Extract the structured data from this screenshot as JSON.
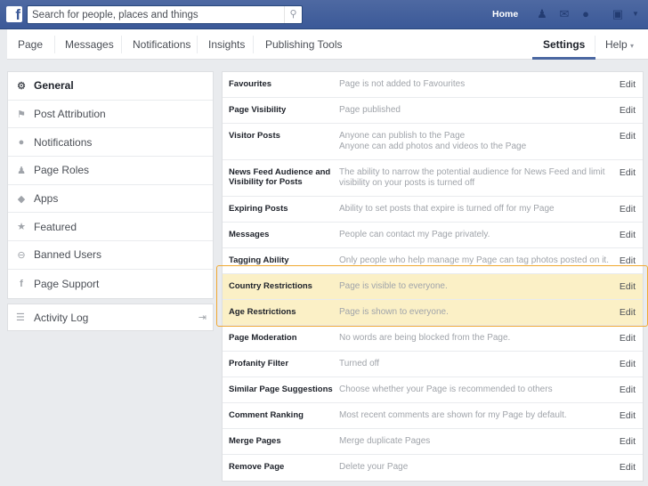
{
  "topbar": {
    "logo": "f",
    "search_placeholder": "Search for people, places and things",
    "search_icon": "search-icon",
    "home_label": "Home",
    "icons": [
      "friend-requests-icon",
      "messages-icon",
      "notifications-globe-icon",
      "account-icon",
      "chevron-down-icon"
    ]
  },
  "pagenav": {
    "tabs": [
      {
        "label": "Page"
      },
      {
        "label": "Messages"
      },
      {
        "label": "Notifications"
      },
      {
        "label": "Insights"
      },
      {
        "label": "Publishing Tools"
      }
    ],
    "settings_label": "Settings",
    "help_label": "Help",
    "help_caret": "▾",
    "active_color": "#4b67a1"
  },
  "sidebar": {
    "items": [
      {
        "label": "General",
        "icon": "gear-icon",
        "glyph": "⚙",
        "active": true
      },
      {
        "label": "Post Attribution",
        "icon": "flag-icon",
        "glyph": "⚑"
      },
      {
        "label": "Notifications",
        "icon": "globe-icon",
        "glyph": "●"
      },
      {
        "label": "Page Roles",
        "icon": "person-icon",
        "glyph": "♟"
      },
      {
        "label": "Apps",
        "icon": "cube-icon",
        "glyph": "◆"
      },
      {
        "label": "Featured",
        "icon": "star-icon",
        "glyph": "★"
      },
      {
        "label": "Banned Users",
        "icon": "banned-icon",
        "glyph": "⊖"
      },
      {
        "label": "Page Support",
        "icon": "facebook-icon",
        "glyph": "f"
      }
    ],
    "activity_log": {
      "label": "Activity Log",
      "icon": "list-icon",
      "glyph": "☰",
      "enter_glyph": "⇥"
    }
  },
  "settings": {
    "edit_label": "Edit",
    "highlight_color": "#f0a830",
    "rows": [
      {
        "name": "Favourites",
        "desc": [
          "Page is not added to Favourites"
        ]
      },
      {
        "name": "Page Visibility",
        "desc": [
          "Page published"
        ]
      },
      {
        "name": "Visitor Posts",
        "desc": [
          "Anyone can publish to the Page",
          "Anyone can add photos and videos to the Page"
        ]
      },
      {
        "name": "News Feed Audience and Visibility for Posts",
        "desc": [
          "The ability to narrow the potential audience for News Feed and limit visibility on your posts is turned off"
        ]
      },
      {
        "name": "Expiring Posts",
        "desc": [
          "Ability to set posts that expire is turned off for my Page"
        ]
      },
      {
        "name": "Messages",
        "desc": [
          "People can contact my Page privately."
        ]
      },
      {
        "name": "Tagging Ability",
        "desc": [
          "Only people who help manage my Page can tag photos posted on it."
        ]
      },
      {
        "name": "Country Restrictions",
        "desc": [
          "Page is visible to everyone."
        ],
        "highlighted": true
      },
      {
        "name": "Age Restrictions",
        "desc": [
          "Page is shown to everyone."
        ],
        "highlighted": true
      },
      {
        "name": "Page Moderation",
        "desc": [
          "No words are being blocked from the Page."
        ]
      },
      {
        "name": "Profanity Filter",
        "desc": [
          "Turned off"
        ]
      },
      {
        "name": "Similar Page Suggestions",
        "desc": [
          "Choose whether your Page is recommended to others"
        ]
      },
      {
        "name": "Comment Ranking",
        "desc": [
          "Most recent comments are shown for my Page by default."
        ]
      },
      {
        "name": "Merge Pages",
        "desc": [
          "Merge duplicate Pages"
        ]
      },
      {
        "name": "Remove Page",
        "desc": [
          "Delete your Page"
        ]
      }
    ]
  }
}
